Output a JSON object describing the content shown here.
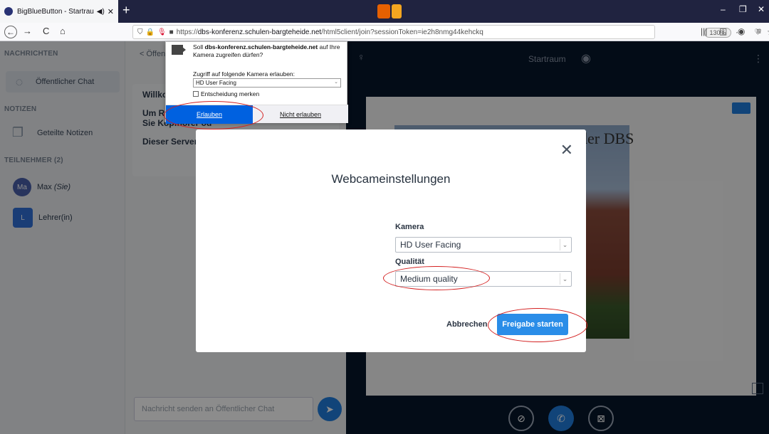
{
  "browser": {
    "tab_title": "BigBlueButton - Startraum",
    "url_host": "dbs-konferenz.schulen-bargteheide.net",
    "url_prefix": "https://",
    "url_path": "/html5client/join?sessionToken=ie2h8nmg44kehckq",
    "zoom": "130%",
    "back_glyph": "←",
    "forward_glyph": "→",
    "reload_glyph": "C",
    "home_glyph": "⌂",
    "tab_sound_glyph": "◀)",
    "tab_close_glyph": "✕",
    "newtab_glyph": "+",
    "shield_glyph": "⛉",
    "lock_glyph": "🔒",
    "mic_glyph": "🎙",
    "cam_glyph": "■",
    "more_glyph": "···",
    "pocket_glyph": "♡",
    "star_glyph": "☆",
    "library_glyph": "|||",
    "sidebar_glyph": "◫",
    "account_glyph": "◉",
    "menu_glyph": "≡",
    "minimize_glyph": "–",
    "restore_glyph": "❐",
    "close_glyph": "✕"
  },
  "sidebar": {
    "messages_header": "NACHRICHTEN",
    "public_chat": "Öffentlicher Chat",
    "notes_header": "NOTIZEN",
    "shared_notes": "Geteilte Notizen",
    "participants_header": "TEILNEHMER (2)",
    "users": [
      {
        "initials": "Ma",
        "name": "Max",
        "suffix": "(Sie)"
      },
      {
        "initials": "L",
        "name": "Lehrer(in)",
        "suffix": ""
      }
    ]
  },
  "chat": {
    "header": "Öffen",
    "lines": [
      "Willko",
      "Um Rückkopplungen zu vermeiden nutzen Sie Kopfhörer od",
      "Dieser Server"
    ],
    "input_placeholder": "Nachricht senden an Öffentlicher Chat",
    "back_glyph": "<",
    "send_glyph": "➤"
  },
  "presentation": {
    "room": "Startraum",
    "slide_title": "der DBS",
    "user_glyph": "♀",
    "record_glyph": "◉",
    "kebab_glyph": "⋮",
    "mic_off_glyph": "⊘",
    "phone_glyph": "✆",
    "cam_off_glyph": "⊠"
  },
  "modal": {
    "title": "Webcameinstellungen",
    "close_glyph": "✕",
    "camera_label": "Kamera",
    "camera_value": "HD User Facing",
    "quality_label": "Qualität",
    "quality_value": "Medium quality",
    "cancel": "Abbrechen",
    "start": "Freigabe starten",
    "arrow_glyph": "⌄"
  },
  "permission": {
    "question_prefix": "Soll ",
    "question_host": "dbs-konferenz.schulen-bargteheide.net",
    "question_suffix": " auf Ihre Kamera zugreifen dürfen?",
    "access_label": "Zugriff auf folgende Kamera erlauben:",
    "camera": "HD User Facing",
    "remember": "Entscheidung merken",
    "allow": "Erlauben",
    "deny": "Nicht erlauben",
    "arrow_glyph": "⌄"
  },
  "colors": {
    "accent_blue": "#2a8de8",
    "firefox_blue": "#0061e0",
    "annotation_red": "#d42020",
    "presentation_bg": "#06172a"
  }
}
